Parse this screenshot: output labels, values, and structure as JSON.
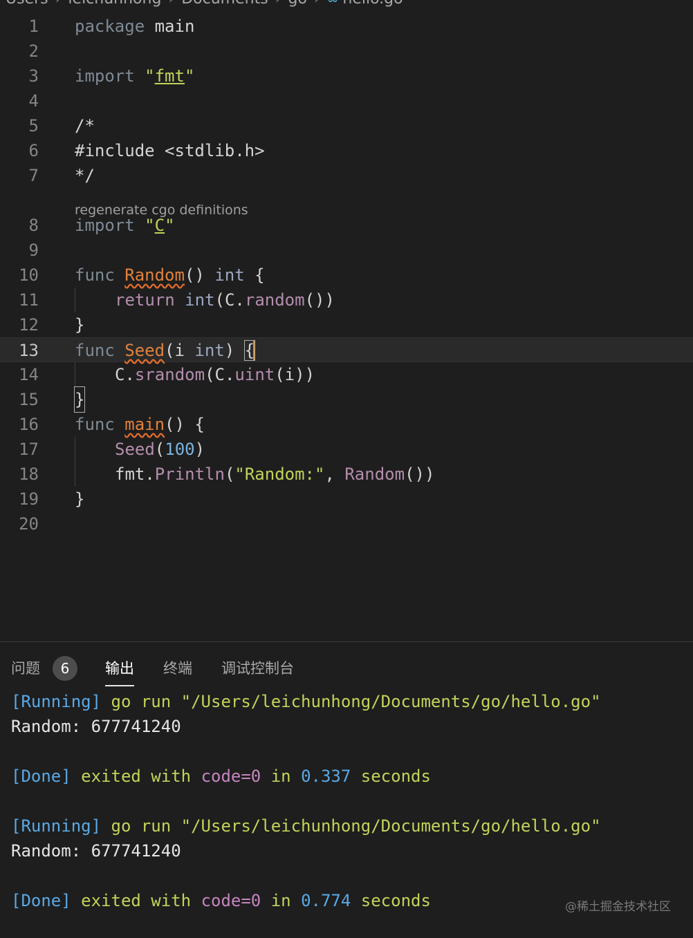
{
  "breadcrumb": {
    "items": [
      "Users",
      "leichunhong",
      "Documents",
      "go"
    ],
    "file_icon": "go-file-icon",
    "file": "hello.go"
  },
  "editor": {
    "codelens": "regenerate cgo definitions",
    "line_numbers": [
      "1",
      "2",
      "3",
      "4",
      "5",
      "6",
      "7",
      "8",
      "9",
      "10",
      "11",
      "12",
      "13",
      "14",
      "15",
      "16",
      "17",
      "18",
      "19",
      "20"
    ],
    "lines": {
      "l1": [
        "package",
        " main"
      ],
      "l3": [
        "import",
        " ",
        "\"",
        "fmt",
        "\""
      ],
      "l5": [
        "/*"
      ],
      "l6": [
        "#include <stdlib.h>"
      ],
      "l7": [
        "*/"
      ],
      "l8": [
        "import",
        " ",
        "\"",
        "C",
        "\""
      ],
      "l10": [
        "func",
        " ",
        "Random",
        "()",
        " ",
        "int",
        " {"
      ],
      "l11": [
        "return",
        " ",
        "int",
        "(C.",
        "random",
        "())"
      ],
      "l12": [
        "}"
      ],
      "l13": [
        "func",
        " ",
        "Seed",
        "(i ",
        "int",
        ") ",
        "{"
      ],
      "l14": [
        "C.",
        "srandom",
        "(C.",
        "uint",
        "(i))"
      ],
      "l15": [
        "}"
      ],
      "l16": [
        "func",
        " ",
        "main",
        "() {"
      ],
      "l17": [
        "Seed",
        "(",
        "100",
        ")"
      ],
      "l18": [
        "fmt.",
        "Println",
        "(",
        "\"Random:\"",
        ", ",
        "Random",
        "())"
      ],
      "l19": [
        "}"
      ]
    }
  },
  "panel": {
    "tabs": {
      "problems": "问题",
      "problems_count": "6",
      "output": "输出",
      "terminal": "终端",
      "debug_console": "调试控制台"
    },
    "output": [
      {
        "tag": "[Running]",
        "cmd": "go run",
        "path": "\"/Users/leichunhong/Documents/go/hello.go\""
      },
      {
        "text": "Random: 677741240"
      },
      {
        "tag": "[Done]",
        "a": "exited with",
        "b": "code=0",
        "c": "in",
        "d": "0.337",
        "e": "seconds"
      },
      {
        "tag": "[Running]",
        "cmd": "go run",
        "path": "\"/Users/leichunhong/Documents/go/hello.go\""
      },
      {
        "text": "Random: 677741240"
      },
      {
        "tag": "[Done]",
        "a": "exited with",
        "b": "code=0",
        "c": "in",
        "d": "0.774",
        "e": "seconds"
      }
    ]
  },
  "watermark": "@稀土掘金技术社区",
  "colors": {
    "background": "#1e1e1e",
    "keyword": "#7f8a95",
    "string": "#c3d35a",
    "function_decl": "#e0823d",
    "call": "#b48ead",
    "output_blue": "#5aa9e6",
    "output_yellow": "#c3d35a",
    "output_purple": "#c586c0"
  }
}
